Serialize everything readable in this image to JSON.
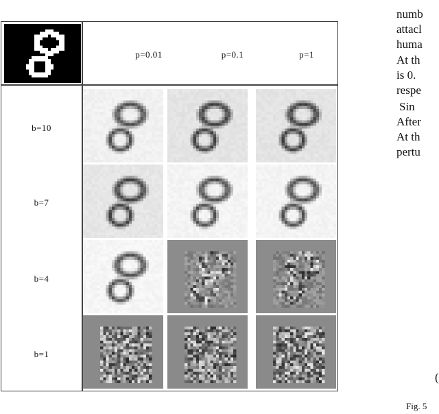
{
  "figure": {
    "column_headers": [
      "p=0.01",
      "p=0.1",
      "p=1"
    ],
    "row_headers": [
      "b=10",
      "b=7",
      "b=4",
      "b=1"
    ],
    "original_image": "mnist-digit-8",
    "cells": [
      [
        {
          "style": "smooth",
          "bg": "#f1f1f1"
        },
        {
          "style": "smooth",
          "bg": "#e4e4e4"
        },
        {
          "style": "smooth",
          "bg": "#e4e4e4"
        }
      ],
      [
        {
          "style": "smooth",
          "bg": "#e6e6e6"
        },
        {
          "style": "smooth",
          "bg": "#f4f4f4"
        },
        {
          "style": "smooth",
          "bg": "#f4f4f4"
        }
      ],
      [
        {
          "style": "smooth",
          "bg": "#f6f6f6"
        },
        {
          "style": "noisy",
          "bg": "#8c8c8c"
        },
        {
          "style": "noisy",
          "bg": "#8c8c8c"
        }
      ],
      [
        {
          "style": "random",
          "bg": "#8a8a8a"
        },
        {
          "style": "random",
          "bg": "#8a8a8a"
        },
        {
          "style": "random",
          "bg": "#8a8a8a"
        }
      ]
    ]
  },
  "right_text": {
    "lines": [
      "numb",
      "attacl",
      "huma",
      "At th",
      "is 0.",
      "respe",
      " Sin",
      "After",
      "At th",
      "pertu"
    ],
    "fragment": "(",
    "caption_fragment": "Fig. 5"
  }
}
